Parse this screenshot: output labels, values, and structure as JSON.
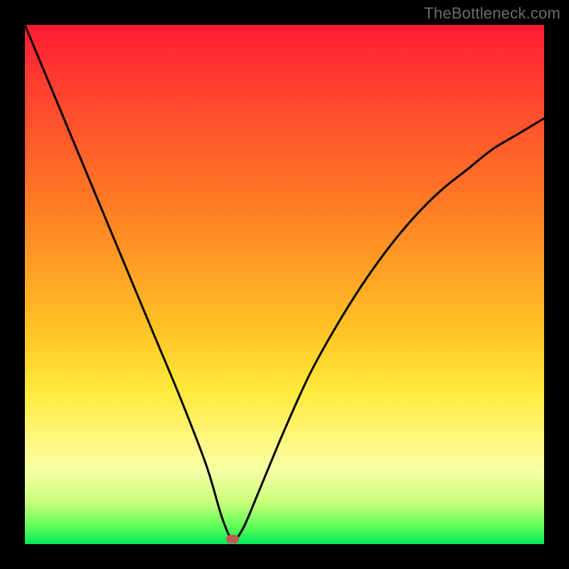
{
  "watermark": "TheBottleneck.com",
  "chart_data": {
    "type": "line",
    "title": "",
    "xlabel": "",
    "ylabel": "",
    "xlim": [
      0,
      100
    ],
    "ylim": [
      0,
      100
    ],
    "grid": false,
    "legend": false,
    "series": [
      {
        "name": "bottleneck-curve",
        "x": [
          0,
          5,
          10,
          15,
          20,
          25,
          30,
          35,
          38,
          40,
          42,
          45,
          50,
          55,
          60,
          65,
          70,
          75,
          80,
          85,
          90,
          95,
          100
        ],
        "y": [
          100,
          88,
          76,
          64,
          52,
          40,
          28,
          15,
          5,
          1,
          3,
          10,
          22,
          33,
          42,
          50,
          57,
          63,
          68,
          72,
          76,
          79,
          82
        ]
      }
    ],
    "marker": {
      "x": 40,
      "y": 1
    },
    "background_gradient": {
      "top_color": "#ff1a33",
      "mid_color": "#ffe83a",
      "bottom_color": "#00e85a"
    }
  }
}
